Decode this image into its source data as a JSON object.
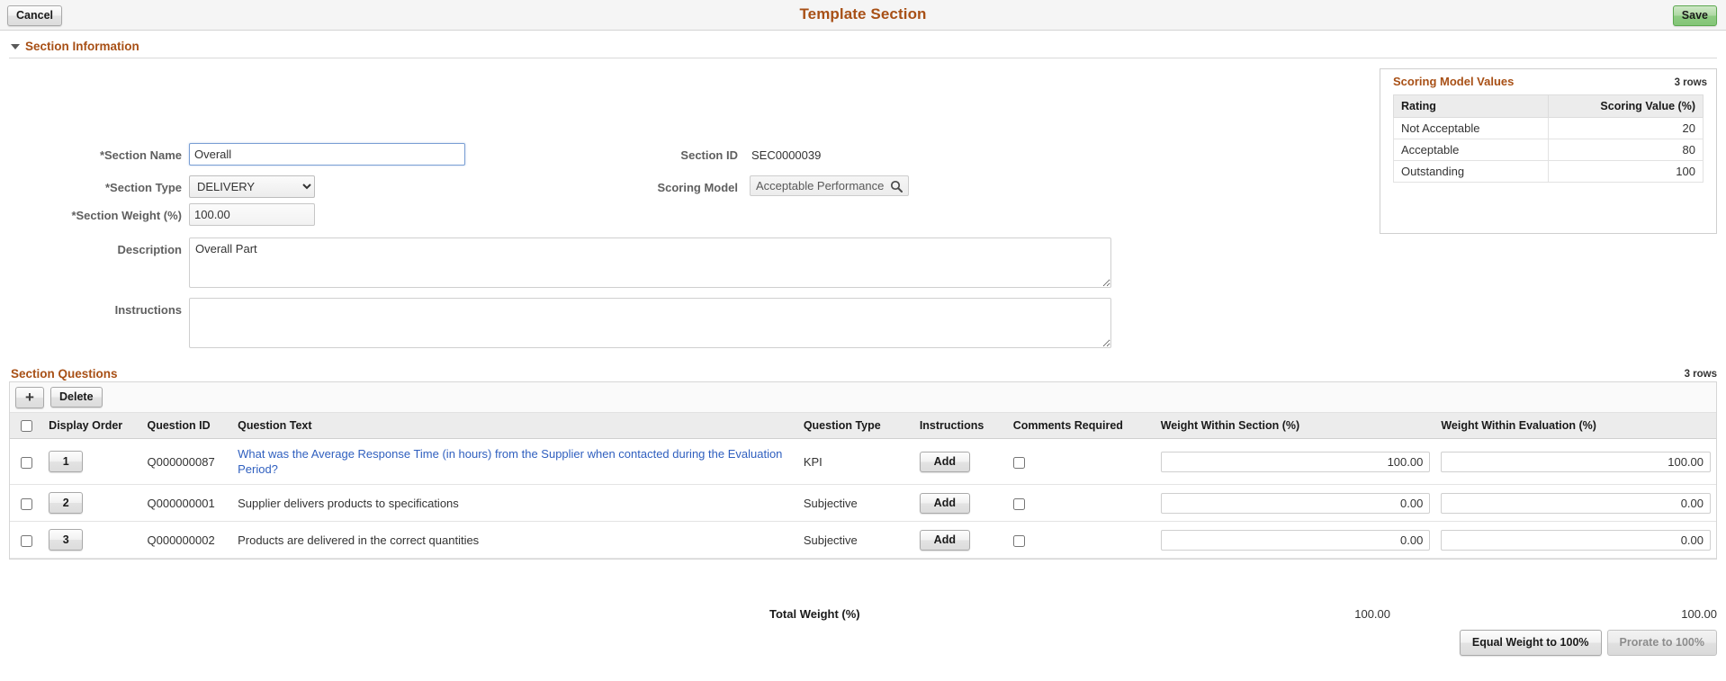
{
  "toolbar": {
    "cancel_label": "Cancel",
    "save_label": "Save",
    "page_title": "Template Section"
  },
  "section_information": {
    "header": "Section Information",
    "collapse_icon": "caret-down-icon",
    "fields": {
      "section_name_label": "*Section Name",
      "section_name_value": "Overall",
      "section_type_label": "*Section Type",
      "section_type_value": "DELIVERY",
      "section_type_options": [
        "DELIVERY"
      ],
      "section_weight_label": "*Section Weight (%)",
      "section_weight_value": "100.00",
      "description_label": "Description",
      "description_value": "Overall Part",
      "instructions_label": "Instructions",
      "instructions_value": "",
      "section_id_label": "Section ID",
      "section_id_value": "SEC0000039",
      "scoring_model_label": "Scoring Model",
      "scoring_model_value": "Acceptable Performance",
      "scoring_model_lookup_icon": "search-icon"
    }
  },
  "scoring_model_values": {
    "title": "Scoring Model Values",
    "row_count": "3 rows",
    "columns": [
      "Rating",
      "Scoring Value (%)"
    ],
    "rows": [
      {
        "rating": "Not Acceptable",
        "value": "20"
      },
      {
        "rating": "Acceptable",
        "value": "80"
      },
      {
        "rating": "Outstanding",
        "value": "100"
      }
    ]
  },
  "section_questions": {
    "title": "Section Questions",
    "row_count": "3 rows",
    "toolbar": {
      "add_row_icon": "plus-icon",
      "add_row_label": "+",
      "delete_label": "Delete"
    },
    "columns": [
      "Display Order",
      "Question ID",
      "Question Text",
      "Question Type",
      "Instructions",
      "Comments Required",
      "Weight Within Section (%)",
      "Weight Within Evaluation (%)"
    ],
    "rows": [
      {
        "selected": false,
        "display_order": "1",
        "question_id": "Q000000087",
        "question_text": "What was the Average Response Time (in hours) from the Supplier when contacted during the Evaluation Period?",
        "question_type": "KPI",
        "instructions_label": "Add",
        "comments_required": false,
        "weight_within_section": "100.00",
        "weight_within_evaluation": "100.00"
      },
      {
        "selected": false,
        "display_order": "2",
        "question_id": "Q000000001",
        "question_text": "Supplier delivers products to specifications",
        "question_type": "Subjective",
        "instructions_label": "Add",
        "comments_required": false,
        "weight_within_section": "0.00",
        "weight_within_evaluation": "0.00"
      },
      {
        "selected": false,
        "display_order": "3",
        "question_id": "Q000000002",
        "question_text": "Products are delivered in the correct quantities",
        "question_type": "Subjective",
        "instructions_label": "Add",
        "comments_required": false,
        "weight_within_section": "0.00",
        "weight_within_evaluation": "0.00"
      }
    ]
  },
  "totals": {
    "label": "Total Weight (%)",
    "weight_within_section": "100.00",
    "weight_within_evaluation": "100.00",
    "equal_weight_label": "Equal Weight to 100%",
    "prorate_label": "Prorate to 100%"
  },
  "colors": {
    "accent": "#a85016",
    "link": "#2f5fbf",
    "save_green": "#8ecb82",
    "header_bg": "#f5f5f5"
  }
}
